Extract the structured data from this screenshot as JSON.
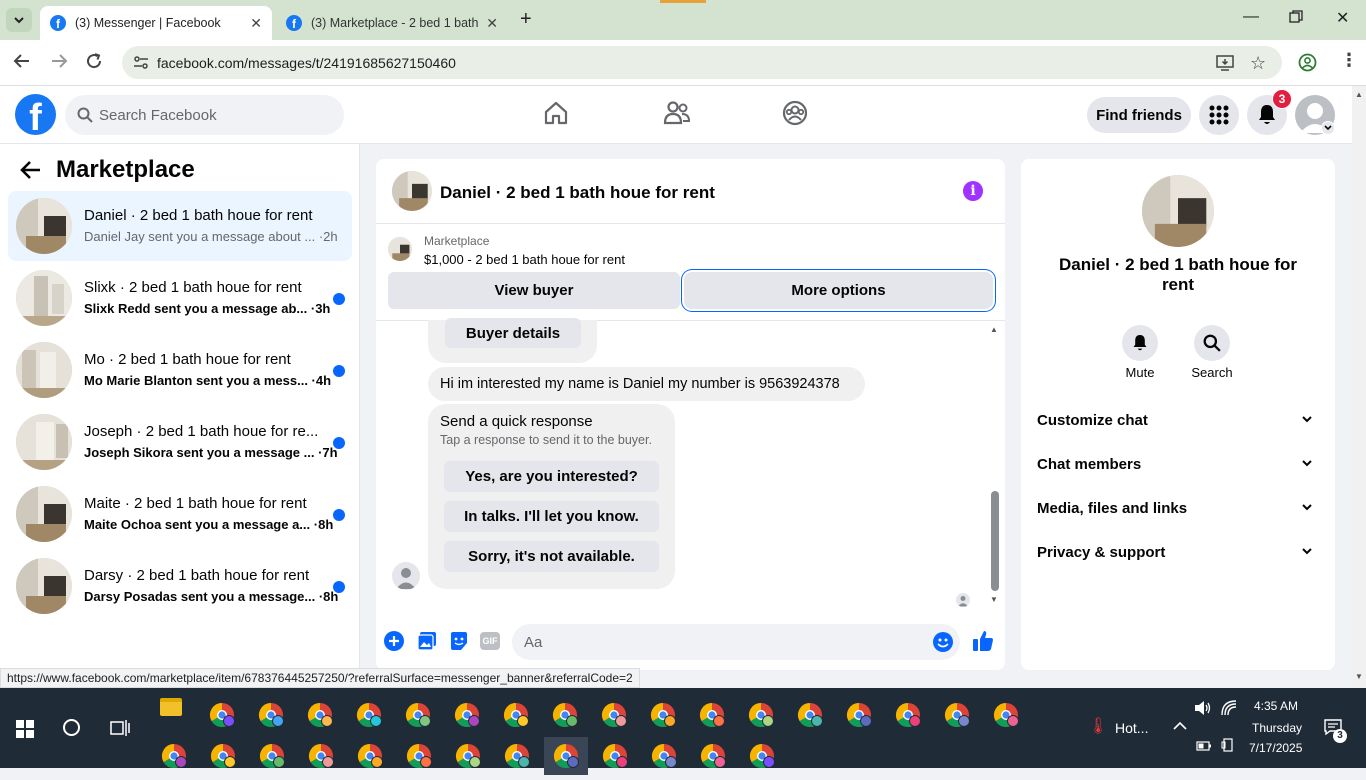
{
  "browser": {
    "tabs": [
      {
        "title": "(3) Messenger | Facebook",
        "active": true
      },
      {
        "title": "(3) Marketplace - 2 bed 1 bath",
        "active": false
      }
    ],
    "url": "facebook.com/messages/t/24191685627150460"
  },
  "fb_header": {
    "search_placeholder": "Search Facebook",
    "find_friends": "Find friends",
    "notifications_count": "3"
  },
  "sidebar": {
    "title": "Marketplace",
    "conversations": [
      {
        "name": "Daniel · 2 bed 1 bath houe for rent",
        "preview": "Daniel Jay sent you a message about ... ·2h",
        "unread": false,
        "selected": true
      },
      {
        "name": "Slixk · 2 bed 1 bath houe for rent",
        "preview": "Slixk Redd sent you a message ab... ·3h",
        "unread": true,
        "selected": false
      },
      {
        "name": "Mo · 2 bed 1 bath houe for rent",
        "preview": "Mo Marie Blanton sent you a mess... ·4h",
        "unread": true,
        "selected": false
      },
      {
        "name": "Joseph · 2 bed 1 bath houe for re...",
        "preview": "Joseph Sikora sent you a message ... ·7h",
        "unread": true,
        "selected": false
      },
      {
        "name": "Maite · 2 bed 1 bath houe for rent",
        "preview": "Maite Ochoa sent you a message a... ·8h",
        "unread": true,
        "selected": false
      },
      {
        "name": "Darsy · 2 bed 1 bath houe for rent",
        "preview": "Darsy Posadas sent you a message... ·8h",
        "unread": true,
        "selected": false
      }
    ]
  },
  "chat": {
    "title": "Daniel · 2 bed 1 bath houe for rent",
    "banner_label": "Marketplace",
    "banner_listing": "$1,000 - 2 bed 1 bath houe for rent",
    "view_buyer": "View buyer",
    "more_options": "More options",
    "buyer_details": "Buyer details",
    "message": "Hi im interested  my name is Daniel my number is 9563924378",
    "quick_response_title": "Send a quick response",
    "quick_response_sub": "Tap a response to send it to the buyer.",
    "quick_responses": [
      "Yes, are you interested?",
      "In talks. I'll let you know.",
      "Sorry, it's not available."
    ],
    "composer_placeholder": "Aa"
  },
  "right_panel": {
    "title": "Daniel · 2 bed 1 bath houe for rent",
    "mute": "Mute",
    "search": "Search",
    "rows": [
      "Customize chat",
      "Chat members",
      "Media, files and links",
      "Privacy & support"
    ]
  },
  "status_url": "https://www.facebook.com/marketplace/item/678376445257250/?referralSurface=messenger_banner&referralCode=2",
  "taskbar": {
    "weather": "Hot...",
    "time": "4:35 AM",
    "day": "Thursday",
    "date": "7/17/2025",
    "notif_count": "3"
  },
  "colors": {
    "fb_blue": "#1877f2",
    "messenger_blue": "#0866ff",
    "info_purple": "#a033ff",
    "badge_red": "#e41e3f"
  }
}
